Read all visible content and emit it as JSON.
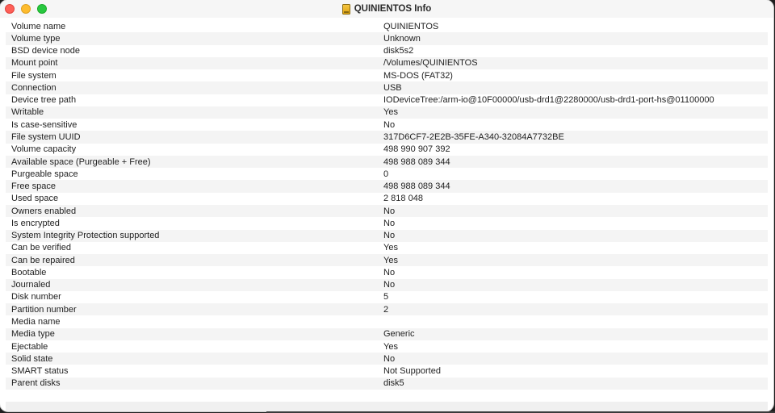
{
  "window": {
    "title": "QUINIENTOS Info"
  },
  "properties": [
    {
      "key": "Volume name",
      "value": "QUINIENTOS"
    },
    {
      "key": "Volume type",
      "value": "Unknown"
    },
    {
      "key": "BSD device node",
      "value": "disk5s2"
    },
    {
      "key": "Mount point",
      "value": "/Volumes/QUINIENTOS"
    },
    {
      "key": "File system",
      "value": "MS-DOS (FAT32)"
    },
    {
      "key": "Connection",
      "value": "USB"
    },
    {
      "key": "Device tree path",
      "value": "IODeviceTree:/arm-io@10F00000/usb-drd1@2280000/usb-drd1-port-hs@01100000"
    },
    {
      "key": "Writable",
      "value": "Yes"
    },
    {
      "key": "Is case-sensitive",
      "value": "No"
    },
    {
      "key": "File system UUID",
      "value": "317D6CF7-2E2B-35FE-A340-32084A7732BE"
    },
    {
      "key": "Volume capacity",
      "value": "498 990 907 392"
    },
    {
      "key": "Available space (Purgeable + Free)",
      "value": "498 988 089 344"
    },
    {
      "key": "Purgeable space",
      "value": "0"
    },
    {
      "key": "Free space",
      "value": "498 988 089 344"
    },
    {
      "key": "Used space",
      "value": "2 818 048"
    },
    {
      "key": "Owners enabled",
      "value": "No"
    },
    {
      "key": "Is encrypted",
      "value": "No"
    },
    {
      "key": "System Integrity Protection supported",
      "value": "No"
    },
    {
      "key": "Can be verified",
      "value": "Yes"
    },
    {
      "key": "Can be repaired",
      "value": "Yes"
    },
    {
      "key": "Bootable",
      "value": "No"
    },
    {
      "key": "Journaled",
      "value": "No"
    },
    {
      "key": "Disk number",
      "value": "5"
    },
    {
      "key": "Partition number",
      "value": "2"
    },
    {
      "key": "Media name",
      "value": ""
    },
    {
      "key": "Media type",
      "value": "Generic"
    },
    {
      "key": "Ejectable",
      "value": "Yes"
    },
    {
      "key": "Solid state",
      "value": "No"
    },
    {
      "key": "SMART status",
      "value": "Not Supported"
    },
    {
      "key": "Parent disks",
      "value": "disk5"
    }
  ]
}
